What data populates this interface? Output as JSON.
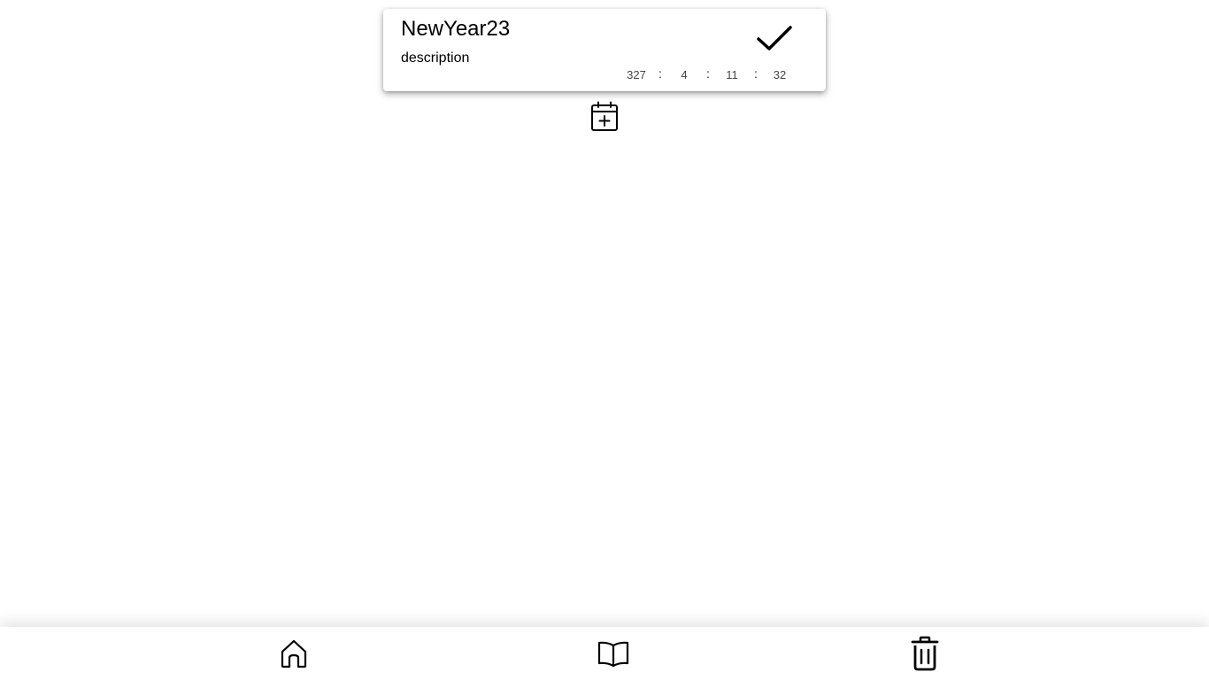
{
  "event_card": {
    "title": "NewYear23",
    "description": "description",
    "complete_icon": "check-icon",
    "countdown": {
      "days": "327",
      "hours": "4",
      "minutes": "11",
      "seconds": "32",
      "separator": ":"
    }
  },
  "actions": {
    "add_event_icon": "calendar-plus-icon"
  },
  "bottom_nav": {
    "items": [
      {
        "icon": "home-icon"
      },
      {
        "icon": "book-icon"
      },
      {
        "icon": "trash-icon"
      }
    ]
  }
}
